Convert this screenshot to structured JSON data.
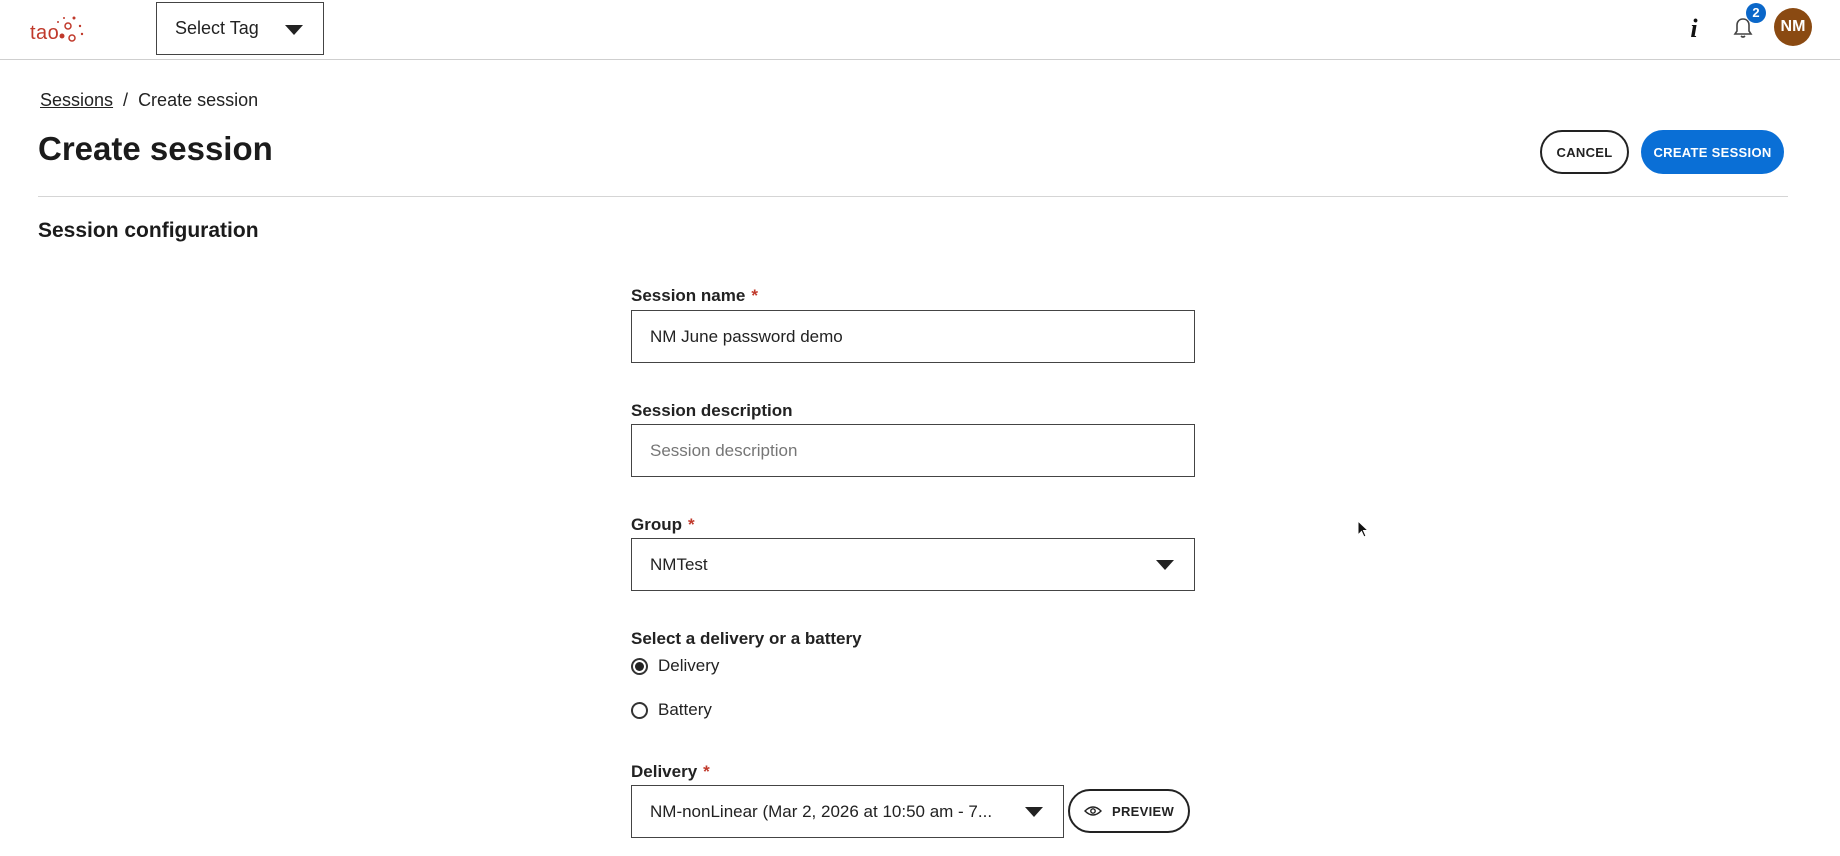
{
  "header": {
    "logo_text": "tao",
    "tag_select": {
      "label": "Select Tag"
    },
    "notifications": {
      "count": "2"
    },
    "avatar_initials": "NM"
  },
  "breadcrumb": {
    "parent": "Sessions",
    "separator": "/",
    "current": "Create session"
  },
  "page": {
    "title": "Create session",
    "cancel_label": "CANCEL",
    "create_label": "CREATE SESSION"
  },
  "section": {
    "title": "Session configuration"
  },
  "form": {
    "session_name": {
      "label": "Session name",
      "required": "*",
      "value": "NM June password demo"
    },
    "session_description": {
      "label": "Session description",
      "placeholder": "Session description",
      "value": ""
    },
    "group": {
      "label": "Group",
      "required": "*",
      "value": "NMTest"
    },
    "delivery_or_battery": {
      "label": "Select a delivery or a battery",
      "options": [
        {
          "label": "Delivery",
          "checked": true
        },
        {
          "label": "Battery",
          "checked": false
        }
      ]
    },
    "delivery": {
      "label": "Delivery",
      "required": "*",
      "value": "NM-nonLinear (Mar 2, 2026 at 10:50 am - 7...",
      "preview_label": "PREVIEW"
    }
  },
  "colors": {
    "primary": "#0a6fd6",
    "badge": "#0a67c9",
    "required": "#c0392b",
    "avatar": "#8a4a12",
    "logo": "#c0392b"
  }
}
